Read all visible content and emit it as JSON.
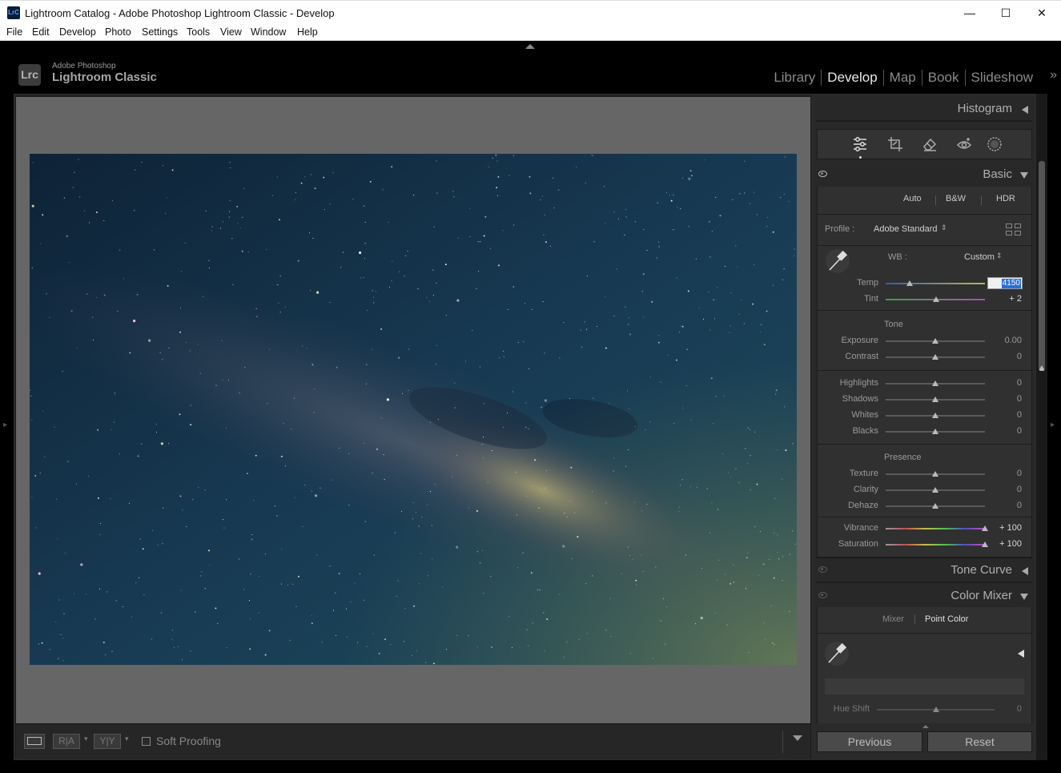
{
  "window": {
    "title": "Lightroom Catalog - Adobe Photoshop Lightroom Classic - Develop",
    "app_icon_text": "LrC",
    "controls": {
      "minimize": "—",
      "maximize": "☐",
      "close": "✕"
    }
  },
  "menu": [
    "File",
    "Edit",
    "Develop",
    "Photo",
    "Settings",
    "Tools",
    "View",
    "Window",
    "Help"
  ],
  "brand": {
    "logo": "Lrc",
    "line1": "Adobe Photoshop",
    "line2": "Lightroom Classic"
  },
  "modules": [
    {
      "label": "Library",
      "active": false
    },
    {
      "label": "Develop",
      "active": true
    },
    {
      "label": "Map",
      "active": false
    },
    {
      "label": "Book",
      "active": false
    },
    {
      "label": "Slideshow",
      "active": false
    }
  ],
  "modules_more": "»",
  "toolbar": {
    "view_mode": "loupe-view",
    "before_after_left": "R|A",
    "before_after_right": "Y|Y",
    "soft_proofing": "Soft Proofing",
    "soft_proofing_checked": false
  },
  "panels": {
    "histogram": "Histogram",
    "tools": [
      "edit-sliders-icon",
      "crop-icon",
      "healing-eraser-icon",
      "red-eye-icon",
      "masking-icon"
    ],
    "basic": {
      "title": "Basic",
      "treatment": [
        "Auto",
        "B&W",
        "HDR"
      ],
      "profile_label": "Profile :",
      "profile_value": "Adobe Standard",
      "wb_label": "WB :",
      "wb_value": "Custom",
      "temp_label": "Temp",
      "temp_value": "4150",
      "tint_label": "Tint",
      "tint_value": "+ 2",
      "tone_section": "Tone",
      "presence_section": "Presence",
      "sliders": [
        {
          "label": "Exposure",
          "value": "0.00",
          "pos": 0.5
        },
        {
          "label": "Contrast",
          "value": "0",
          "pos": 0.5
        },
        {
          "label": "Highlights",
          "value": "0",
          "pos": 0.5
        },
        {
          "label": "Shadows",
          "value": "0",
          "pos": 0.5
        },
        {
          "label": "Whites",
          "value": "0",
          "pos": 0.5
        },
        {
          "label": "Blacks",
          "value": "0",
          "pos": 0.5
        },
        {
          "label": "Texture",
          "value": "0",
          "pos": 0.5
        },
        {
          "label": "Clarity",
          "value": "0",
          "pos": 0.5
        },
        {
          "label": "Dehaze",
          "value": "0",
          "pos": 0.5
        },
        {
          "label": "Vibrance",
          "value": "+ 100",
          "pos": 1.0
        },
        {
          "label": "Saturation",
          "value": "+ 100",
          "pos": 1.0
        }
      ],
      "temp_pos": 0.24,
      "tint_pos": 0.51
    },
    "tone_curve": "Tone Curve",
    "color_mixer": {
      "title": "Color Mixer",
      "tabs": [
        "Mixer",
        "Point Color"
      ],
      "active_tab": "Point Color",
      "hue_shift_label": "Hue Shift",
      "hue_shift_value": "0"
    }
  },
  "buttons": {
    "previous": "Previous",
    "reset": "Reset"
  },
  "colors": {
    "accent": "#2a70d8",
    "panel_bg": "#282828",
    "canvas_bg": "#666666"
  }
}
